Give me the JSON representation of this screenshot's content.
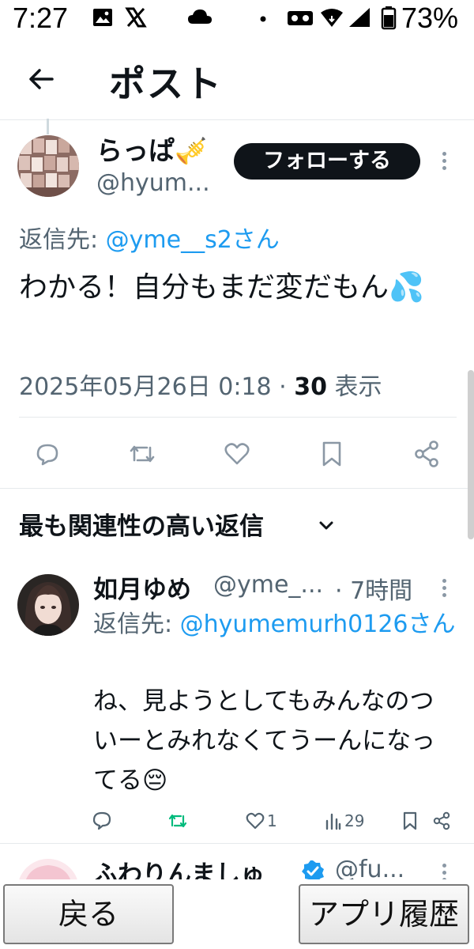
{
  "status_bar": {
    "time": "7:27",
    "battery": "73%",
    "icons": [
      "image-icon",
      "x-logo-icon",
      "cloud-icon",
      "dot-icon",
      "voicemail-icon",
      "wifi-icon",
      "signal-icon",
      "battery-icon"
    ]
  },
  "header": {
    "title": "ポスト",
    "back_icon": "back-arrow-icon"
  },
  "post": {
    "author_name": "らっぱ🎺",
    "handle": "@hyum...",
    "follow_label": "フォローする",
    "reply_to_prefix": "返信先: ",
    "reply_to_mention": "@yme__s2さん",
    "text": "わかる！自分もまだ変だもん💦",
    "timestamp": "2025年05月26日 0:18 · ",
    "views_count": "30",
    "views_label": " 表示",
    "actions": [
      "reply-icon",
      "retweet-icon",
      "like-icon",
      "bookmark-icon",
      "share-icon"
    ]
  },
  "replies_section": {
    "title": "最も関連性の高い返信"
  },
  "reply": {
    "name": "如月ゆめ",
    "handle": "@yme_...",
    "time": "· 7時間",
    "reply_to_prefix": "返信先: ",
    "reply_to_mention": "@hyumemurh0126さん",
    "text": "ね、見ようとしてもみんなのついーとみれなくてうーんになってる😔",
    "likes": "1",
    "views": "29"
  },
  "next_reply": {
    "name": "ふわりんましゅ",
    "handle": "@fu..."
  },
  "bottom_nav": {
    "back_label": "戻る",
    "history_label": "アプリ履歴"
  },
  "colors": {
    "accent": "#1d9bf0",
    "text": "#0f1419",
    "muted": "#536471",
    "retweet_green": "#00ba7c"
  }
}
